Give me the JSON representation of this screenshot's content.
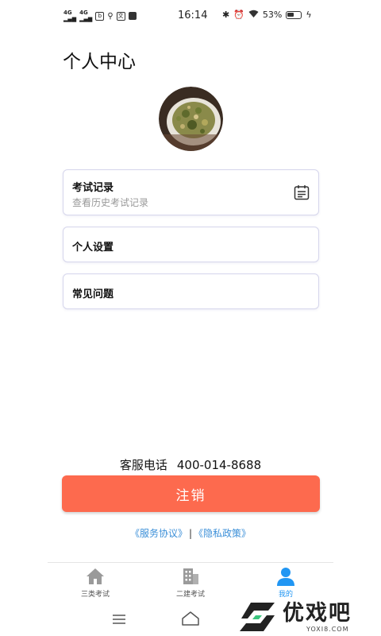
{
  "status_bar": {
    "network1": "4G",
    "network2": "4G",
    "time": "16:14",
    "battery_percent": "53%",
    "battery_level": 0.53
  },
  "page": {
    "title": "个人中心"
  },
  "menu": {
    "items": [
      {
        "title": "考试记录",
        "subtitle": "查看历史考试记录",
        "icon": "calendar-icon"
      },
      {
        "title": "个人设置"
      },
      {
        "title": "常见问题"
      }
    ]
  },
  "service": {
    "label": "客服电话",
    "phone": "400-014-8688"
  },
  "logout": {
    "label": "注销"
  },
  "links": {
    "service_agreement": "《服务协议》",
    "separator": "|",
    "privacy_policy": "《隐私政策》"
  },
  "tabs": [
    {
      "label": "三类考试",
      "icon": "house-icon",
      "active": false
    },
    {
      "label": "二建考试",
      "icon": "building-icon",
      "active": false
    },
    {
      "label": "我的",
      "icon": "person-icon",
      "active": true
    }
  ],
  "watermark": {
    "name": "优戏吧",
    "site": "YOXI8.COM"
  },
  "colors": {
    "accent": "#fd6a4e",
    "link": "#3b8fd8",
    "active_tab": "#2196f3",
    "card_border": "#d6d6ec"
  }
}
